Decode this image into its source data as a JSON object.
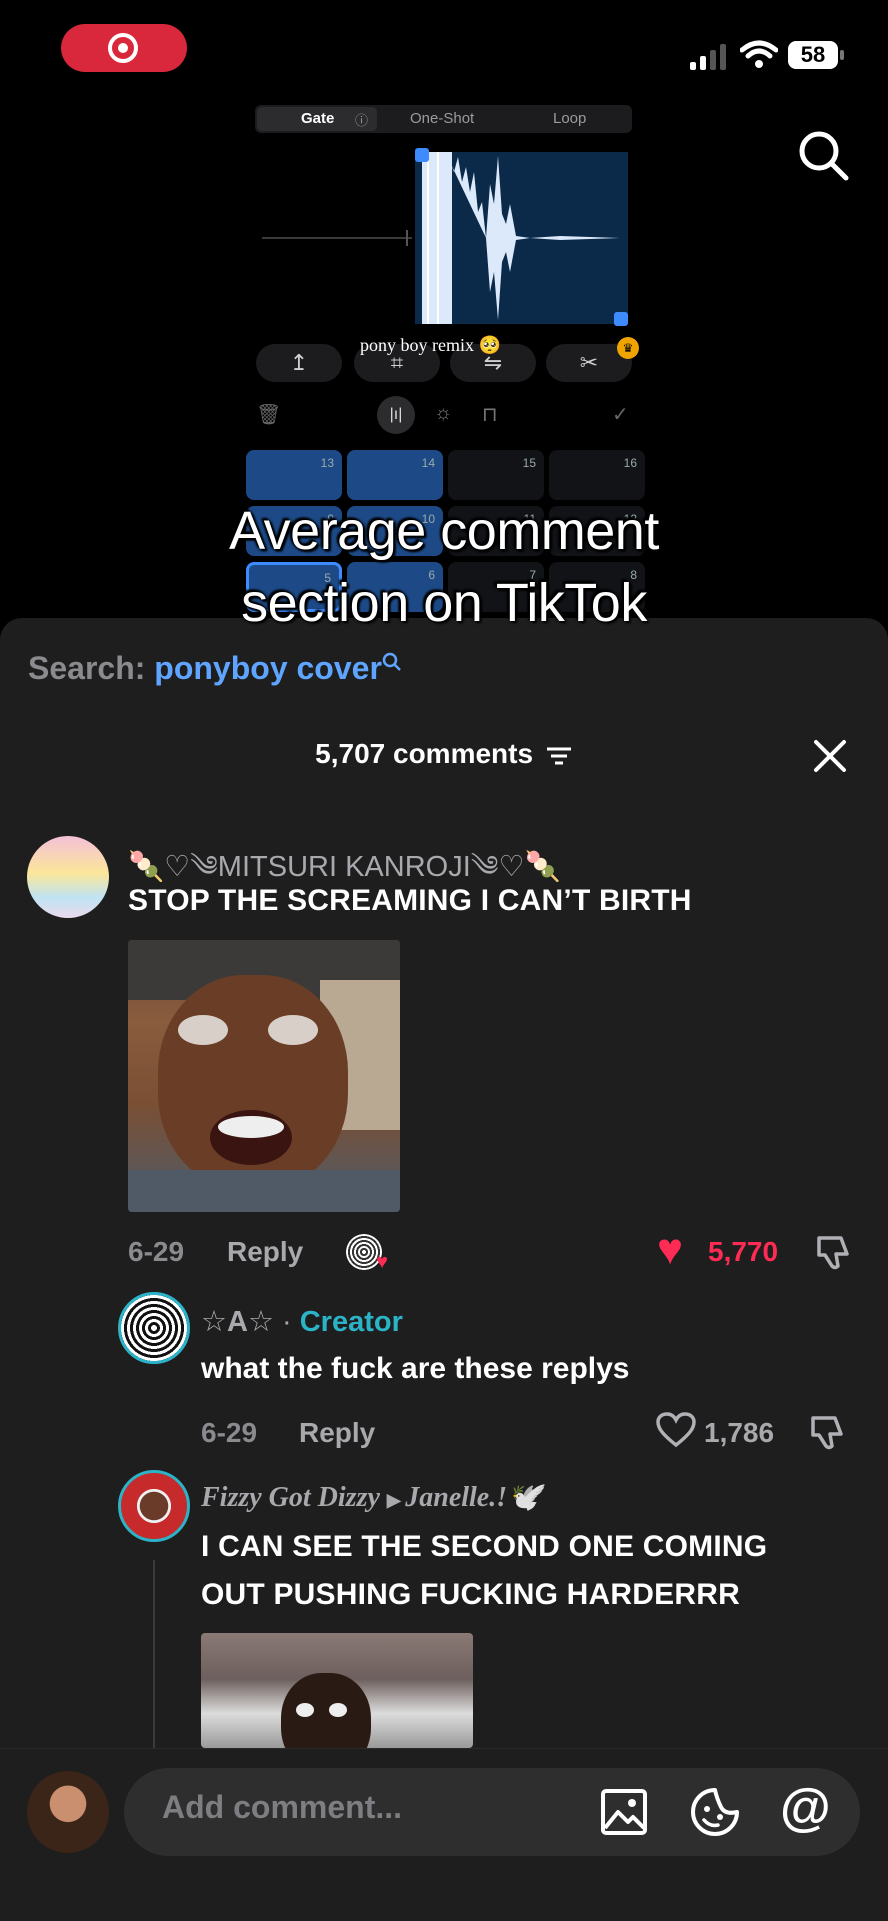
{
  "status": {
    "battery": "58"
  },
  "video": {
    "tabs": [
      "Gate",
      "One-Shot",
      "Loop"
    ],
    "caption": "pony boy remix 🥺",
    "pads_top": [
      "13",
      "14",
      "15",
      "16"
    ],
    "pads_mid": [
      "9",
      "10",
      "11",
      "12"
    ],
    "pads_bot": [
      "5",
      "6",
      "7",
      "8"
    ],
    "overlay_line1": "Average comment",
    "overlay_line2": "section on TikTok"
  },
  "search": {
    "label": "Search:",
    "query": "ponyboy cover"
  },
  "comments_header": {
    "count": "5,707 comments"
  },
  "comments": [
    {
      "user": "🍡♡༄MITSURI KANROJI༄♡🍡",
      "text": "STOP THE SCREAMING I CAN’T BIRTH",
      "date": "6-29",
      "reply": "Reply",
      "likes": "5,770"
    }
  ],
  "replies": [
    {
      "user": "☆A☆",
      "sep": " · ",
      "badge": "Creator",
      "text": "what the fuck are these replys",
      "date": "6-29",
      "reply": "Reply",
      "likes": "1,786"
    },
    {
      "user": "Fizzy Got Dizzy",
      "to": "Janelle.!🕊️",
      "text_line1": "I CAN SEE THE SECOND ONE COMING",
      "text_line2": "OUT PUSHING FUCKING HARDERRR"
    }
  ],
  "composer": {
    "placeholder": "Add comment..."
  },
  "colors": {
    "like_red": "#fe2c55",
    "creator_teal": "#2bb3c8",
    "search_blue": "#5fa5ff",
    "target_red": "#d9283b"
  }
}
